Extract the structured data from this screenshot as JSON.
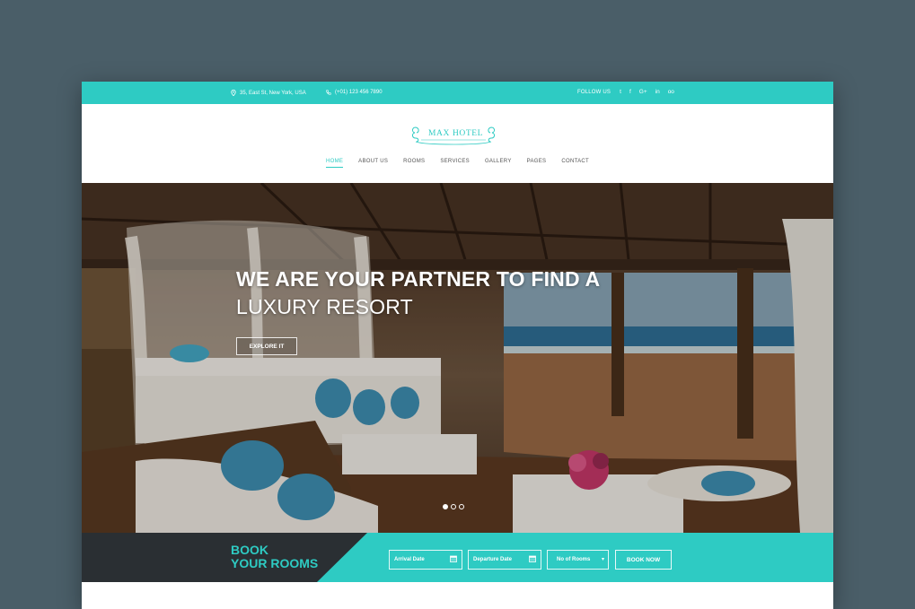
{
  "topbar": {
    "address": "35, East St, New York, USA",
    "phone": "(+01) 123 456 7890",
    "follow_label": "FOLLOW US",
    "social": [
      {
        "icon": "twitter-icon",
        "glyph": "t"
      },
      {
        "icon": "facebook-icon",
        "glyph": "f"
      },
      {
        "icon": "google-plus-icon",
        "glyph": "G+"
      },
      {
        "icon": "linkedin-icon",
        "glyph": "in"
      },
      {
        "icon": "tripadvisor-icon",
        "glyph": "oo"
      }
    ]
  },
  "header": {
    "logo_text": "MAX HOTEL"
  },
  "nav": {
    "items": [
      "HOME",
      "ABOUT US",
      "ROOMS",
      "SERVICES",
      "GALLERY",
      "PAGES",
      "CONTACT"
    ],
    "active": "HOME"
  },
  "hero": {
    "title": "WE ARE YOUR PARTNER TO FIND A",
    "subtitle": "LUXURY RESORT",
    "cta": "EXPLORE IT",
    "slides": 3,
    "active_slide": 1
  },
  "booking": {
    "title_line1": "BOOK",
    "title_line2": "YOUR ROOMS",
    "arrival_placeholder": "Arrival Date",
    "departure_placeholder": "Departure Date",
    "rooms_placeholder": "No of Rooms",
    "submit": "BOOK NOW"
  },
  "colors": {
    "accent": "#2ecbc3",
    "dark": "#2a2f33",
    "background": "#4a5e68"
  }
}
